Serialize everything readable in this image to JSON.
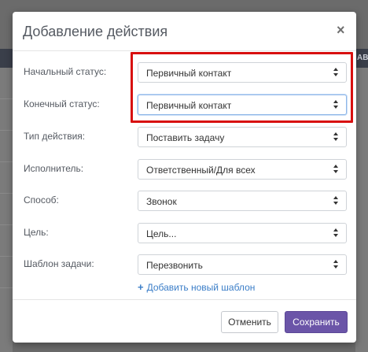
{
  "background": {
    "right_band_text": "АВ"
  },
  "modal": {
    "title": "Добавление действия",
    "close_glyph": "×",
    "fields": [
      {
        "label": "Начальный статус:",
        "value": "Первичный контакт"
      },
      {
        "label": "Конечный статус:",
        "value": "Первичный контакт"
      },
      {
        "label": "Тип действия:",
        "value": "Поставить задачу"
      },
      {
        "label": "Исполнитель:",
        "value": "Ответственный/Для всех"
      },
      {
        "label": "Способ:",
        "value": "Звонок"
      },
      {
        "label": "Цель:",
        "value": "Цель..."
      },
      {
        "label": "Шаблон задачи:",
        "value": "Перезвонить"
      }
    ],
    "add_template": {
      "plus": "+",
      "label": "Добавить новый шаблон"
    },
    "footer": {
      "cancel_label": "Отменить",
      "save_label": "Сохранить"
    }
  },
  "colors": {
    "accent": "#6b55a8",
    "highlight": "#d80f0f",
    "link": "#3b7ec8"
  },
  "icons": {
    "close": "close-icon",
    "select_arrows": "select-arrows-icon",
    "add": "plus-icon"
  }
}
